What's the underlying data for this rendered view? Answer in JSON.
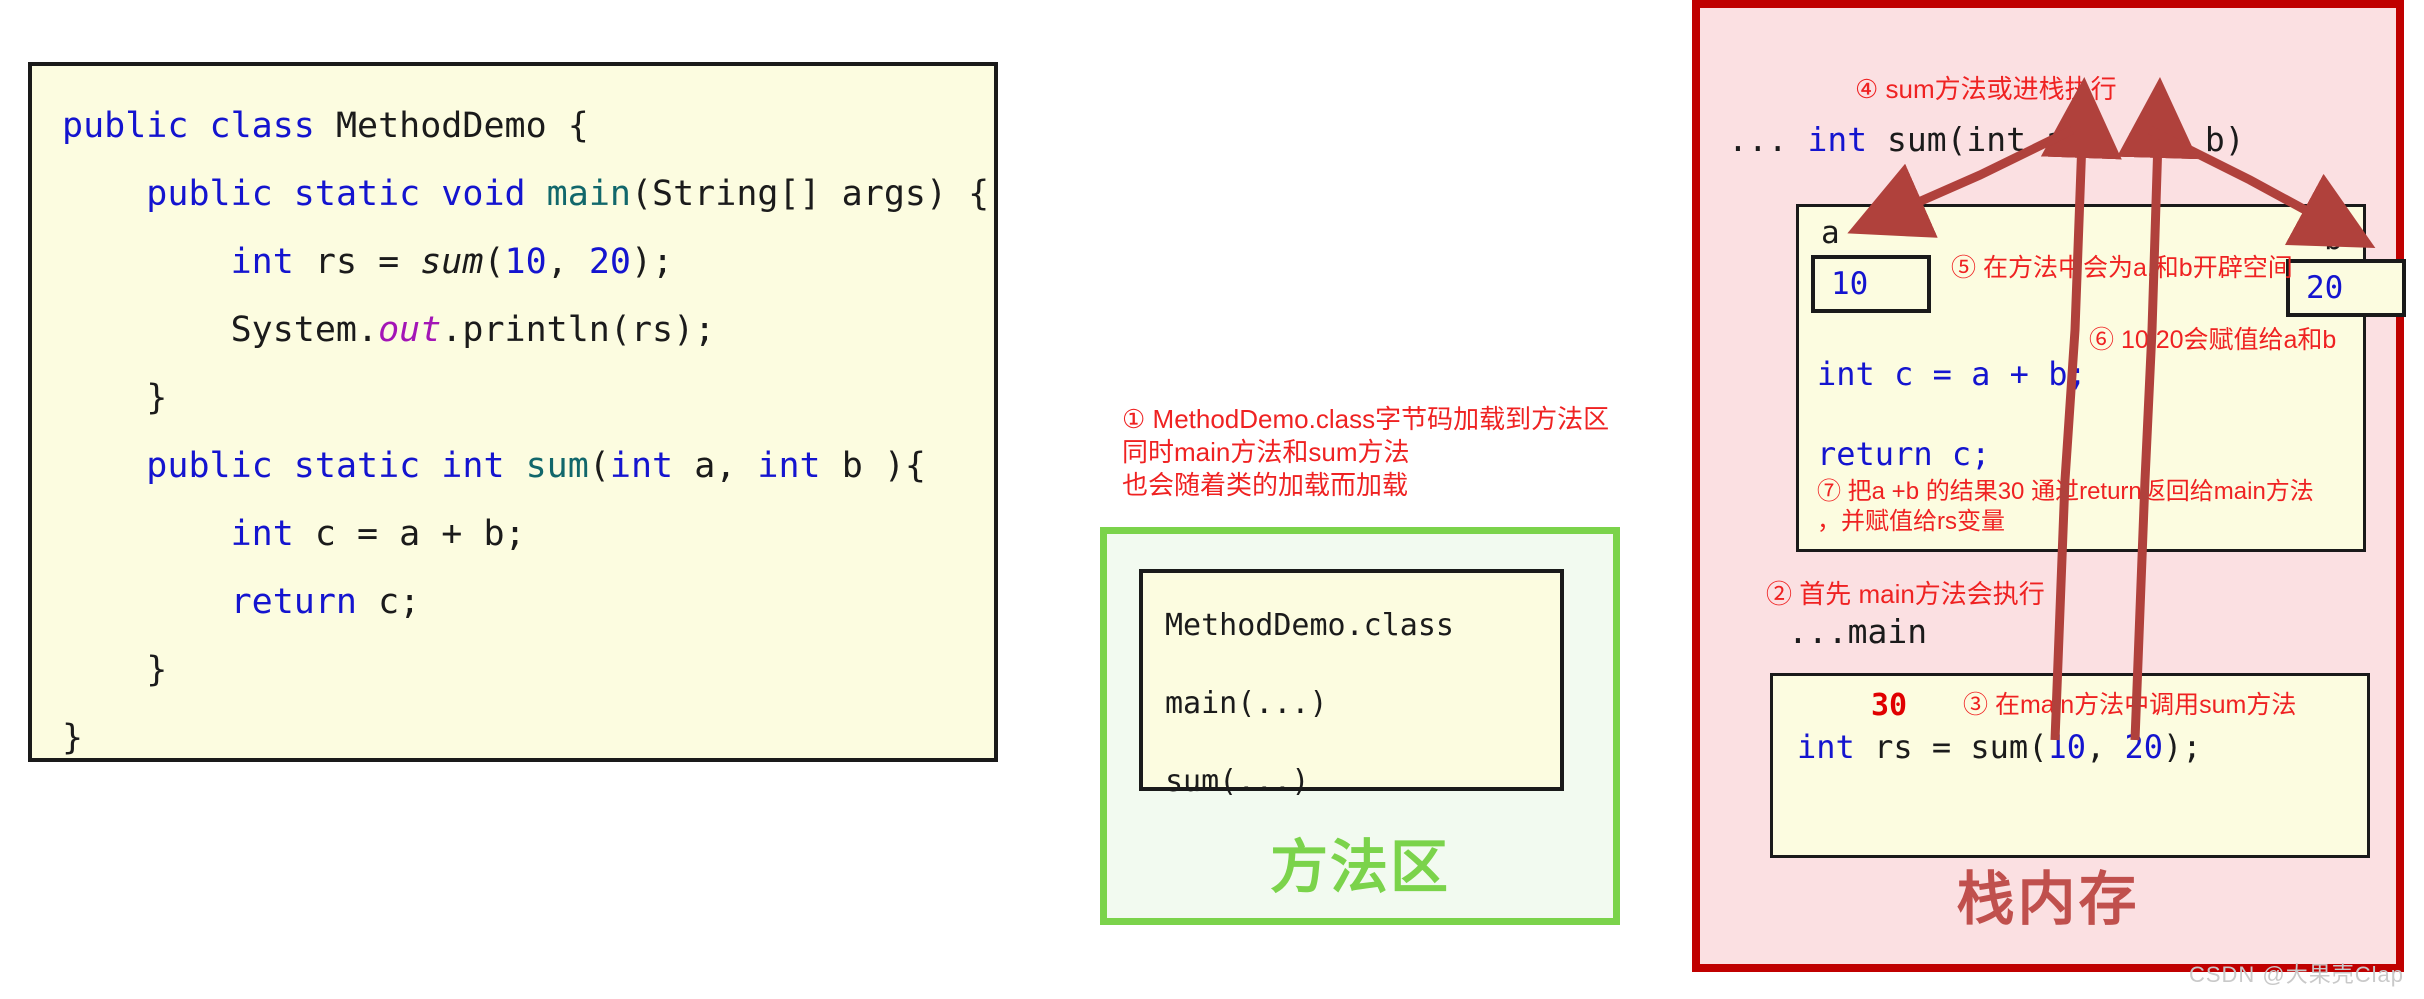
{
  "code_panel": {
    "lines": [
      [
        {
          "t": "public class ",
          "c": "kw"
        },
        {
          "t": "MethodDemo {",
          "c": "plain"
        }
      ],
      [
        {
          "t": "    ",
          "c": "plain"
        },
        {
          "t": "public static void ",
          "c": "kw"
        },
        {
          "t": "main",
          "c": "meth"
        },
        {
          "t": "(String[] args) {",
          "c": "plain"
        }
      ],
      [
        {
          "t": "        ",
          "c": "plain"
        },
        {
          "t": "int ",
          "c": "kw"
        },
        {
          "t": "rs = ",
          "c": "plain"
        },
        {
          "t": "sum",
          "c": "meth-it"
        },
        {
          "t": "(",
          "c": "plain"
        },
        {
          "t": "10",
          "c": "num"
        },
        {
          "t": ", ",
          "c": "plain"
        },
        {
          "t": "20",
          "c": "num"
        },
        {
          "t": ");",
          "c": "plain"
        }
      ],
      [
        {
          "t": "        System.",
          "c": "plain"
        },
        {
          "t": "out",
          "c": "fld-it"
        },
        {
          "t": ".println(rs);",
          "c": "plain"
        }
      ],
      [
        {
          "t": "    }",
          "c": "plain"
        }
      ],
      [
        {
          "t": "    ",
          "c": "plain"
        },
        {
          "t": "public static int ",
          "c": "kw"
        },
        {
          "t": "sum",
          "c": "meth"
        },
        {
          "t": "(",
          "c": "plain"
        },
        {
          "t": "int ",
          "c": "kw"
        },
        {
          "t": "a, ",
          "c": "plain"
        },
        {
          "t": "int ",
          "c": "kw"
        },
        {
          "t": "b ){",
          "c": "plain"
        }
      ],
      [
        {
          "t": "        ",
          "c": "plain"
        },
        {
          "t": "int ",
          "c": "kw"
        },
        {
          "t": "c = a + b;",
          "c": "plain"
        }
      ],
      [
        {
          "t": "        ",
          "c": "plain"
        },
        {
          "t": "return ",
          "c": "kw"
        },
        {
          "t": "c;",
          "c": "plain"
        }
      ],
      [
        {
          "t": "    }",
          "c": "plain"
        }
      ],
      [
        {
          "t": "}",
          "c": "plain"
        }
      ]
    ]
  },
  "method_area": {
    "note": "① MethodDemo.class字节码加载到方法区\n同时main方法和sum方法\n也会随着类的加载而加载",
    "class_name": "MethodDemo.class",
    "method_main": "main(...)",
    "method_sum": "sum(...)",
    "title": "方法区",
    "accent_color": "#7bd34b"
  },
  "stack_memory": {
    "title": "栈内存",
    "accent_color": "#c00000",
    "note_4": "④ sum方法或进栈执行",
    "sum_signature_prefix": "... ",
    "sum_signature_kw": "int",
    "sum_signature_rest": " sum(int a , int b)",
    "sum_frame": {
      "label_a": "a",
      "label_b": "b",
      "value_a": "10",
      "value_b": "20",
      "note_5": "⑤ 在方法中会为a,和b开辟空间",
      "note_6": "⑥ 10,20会赋值给a和b",
      "line_c": "int c = a + b;",
      "line_return": "return c;",
      "note_7": "⑦ 把a +b 的结果30 通过return返回给main方法\n，并赋值给rs变量"
    },
    "note_2": "② 首先 main方法会执行",
    "main_label": "...main",
    "main_frame": {
      "result_value": "30",
      "note_3": "③ 在main方法中调用sum方法",
      "line_rs": "int rs = sum(10, 20);"
    }
  },
  "watermark": "CSDN @大果壳Clap"
}
